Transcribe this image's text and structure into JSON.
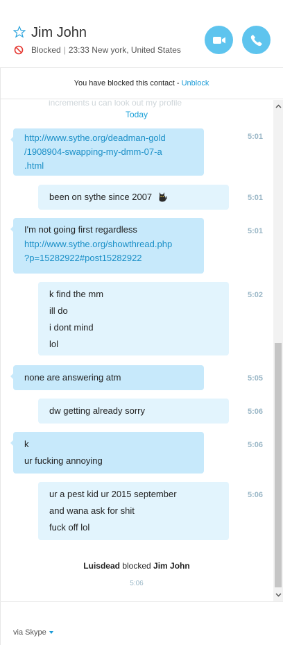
{
  "header": {
    "contact_name": "Jim John",
    "status_blocked": "Blocked",
    "status_time_location": "23:33 New york, United States",
    "icons": [
      "star-icon",
      "blocked-icon",
      "video-call-icon",
      "phone-icon"
    ],
    "accent": "#5ec4ee"
  },
  "notice": {
    "text": "You have blocked this contact - ",
    "action": "Unblock"
  },
  "chat": {
    "ghost_text": "increments u can look out my profile",
    "day_label": "Today",
    "messages": [
      {
        "direction": "in",
        "lines": [],
        "links": [
          "http://www.sythe.org/deadman-gold",
          "/1908904-swapping-my-dmm-07-a",
          ".html"
        ],
        "time": "5:01"
      },
      {
        "direction": "out",
        "lines": [
          "been on sythe since 2007"
        ],
        "emoji": "black-cat-emoji",
        "time": "5:01"
      },
      {
        "direction": "in",
        "lines": [
          "I'm not going first regardless"
        ],
        "links": [
          "http://www.sythe.org/showthread.php",
          "?p=15282922#post15282922"
        ],
        "time": "5:01"
      },
      {
        "direction": "out",
        "lines": [
          "k find the mm",
          "ill do",
          "i dont mind",
          "lol"
        ],
        "time": "5:02"
      },
      {
        "direction": "in",
        "lines": [
          "none are answering atm"
        ],
        "time": "5:05"
      },
      {
        "direction": "out",
        "lines": [
          "dw getting already sorry"
        ],
        "time": "5:06"
      },
      {
        "direction": "in",
        "lines": [
          "k",
          "ur fucking annoying"
        ],
        "time": "5:06"
      },
      {
        "direction": "out",
        "lines": [
          "ur a pest kid ur 2015 september",
          "and wana ask for shit",
          "fuck off lol"
        ],
        "time": "5:06"
      }
    ],
    "system_event": {
      "actor": "Luisdead",
      "verb": " blocked ",
      "target": "Jim John",
      "time": "5:06"
    }
  },
  "footer": {
    "via_label": "via Skype"
  },
  "colors": {
    "incoming_bubble": "#c7e9fb",
    "outgoing_bubble": "#e2f4fd",
    "link": "#1a8fc7",
    "timestamp": "#99b6c6"
  }
}
